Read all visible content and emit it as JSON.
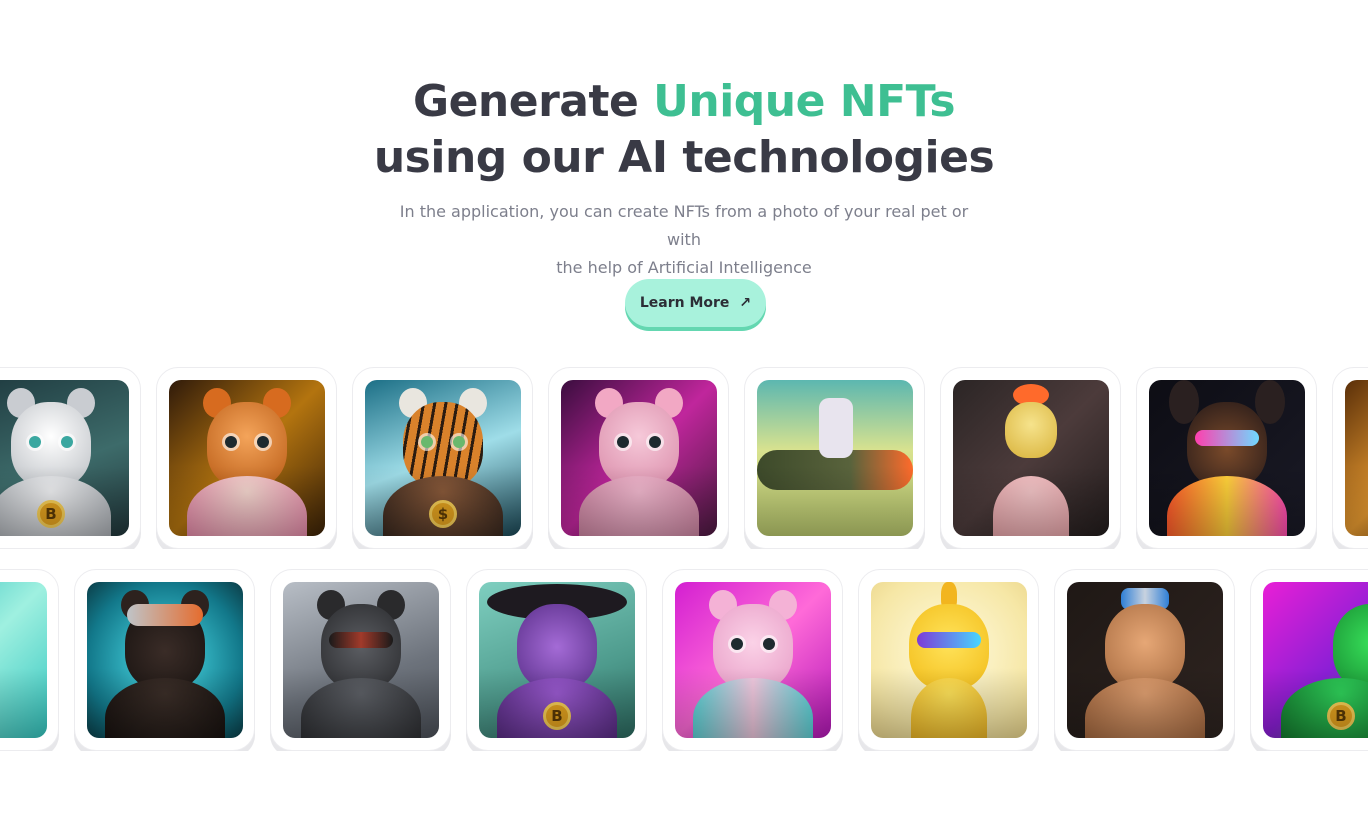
{
  "hero": {
    "title_part1": "Generate ",
    "title_highlight": "Unique NFTs",
    "title_line2": "using our AI technologies",
    "subtitle_line1": "In the application, you can create NFTs from a photo of your real pet or with",
    "subtitle_line2": "the help of Artificial Intelligence",
    "cta_label": "Learn More",
    "cta_icon": "arrow-up-right-icon",
    "highlight_color": "#3ebf92",
    "cta_color": "#a8f2dc"
  },
  "gallery": {
    "row1": [
      {
        "subject": "kitten-with-bitcoin-chain",
        "icon": "coin-icon",
        "coin_text": "B"
      },
      {
        "subject": "squirrel-tongue-out"
      },
      {
        "subject": "tiger-in-hoodie",
        "icon": "coin-icon",
        "coin_text": "$"
      },
      {
        "subject": "rat-in-subway"
      },
      {
        "subject": "crocodile-rocket-rider"
      },
      {
        "subject": "rooster-dj"
      },
      {
        "subject": "doberman-neon-glasses"
      },
      {
        "subject": "partial-card"
      }
    ],
    "row2": [
      {
        "subject": "partial-card"
      },
      {
        "subject": "bear-with-cap"
      },
      {
        "subject": "gorilla-headphones"
      },
      {
        "subject": "lizard-in-hat",
        "icon": "coin-icon",
        "coin_text": "B"
      },
      {
        "subject": "pink-bear"
      },
      {
        "subject": "unicorn-headphones"
      },
      {
        "subject": "golden-dog-crown"
      },
      {
        "subject": "green-iguana",
        "icon": "coin-icon",
        "coin_text": "B"
      }
    ]
  }
}
